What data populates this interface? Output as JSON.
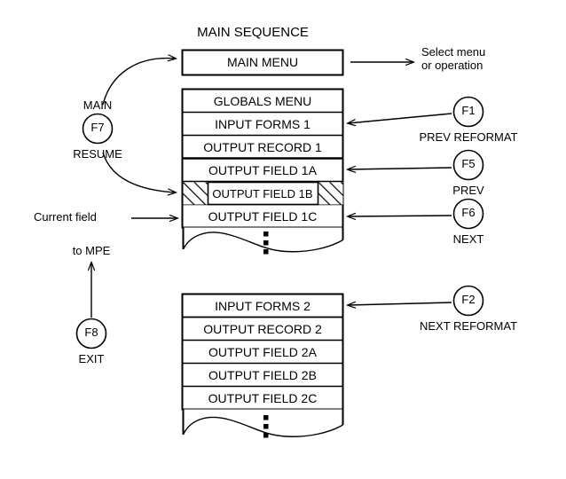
{
  "diagram": {
    "title": "MAIN SEQUENCE",
    "note_select": "Select menu\nor operation",
    "note_current_field": "Current field",
    "note_to_mpe": "to MPE",
    "main_menu": "MAIN MENU",
    "stack1": [
      "GLOBALS MENU",
      "INPUT FORMS 1",
      "OUTPUT RECORD 1",
      "OUTPUT FIELD 1A",
      "OUTPUT FIELD 1B",
      "OUTPUT FIELD 1C"
    ],
    "stack2": [
      "INPUT FORMS 2",
      "OUTPUT RECORD 2",
      "OUTPUT FIELD 2A",
      "OUTPUT FIELD 2B",
      "OUTPUT FIELD 2C"
    ],
    "keys": {
      "f7": {
        "key": "F7",
        "above": "MAIN",
        "below": "RESUME"
      },
      "f8": {
        "key": "F8",
        "above": "",
        "below": "EXIT"
      },
      "f1": {
        "key": "F1",
        "above": "",
        "below": "PREV REFORMAT"
      },
      "f5": {
        "key": "F5",
        "above": "",
        "below": "PREV"
      },
      "f6": {
        "key": "F6",
        "above": "",
        "below": "NEXT"
      },
      "f2": {
        "key": "F2",
        "above": "",
        "below": "NEXT REFORMAT"
      }
    },
    "colors": {
      "ink": "#000000",
      "paper": "#ffffff"
    }
  }
}
